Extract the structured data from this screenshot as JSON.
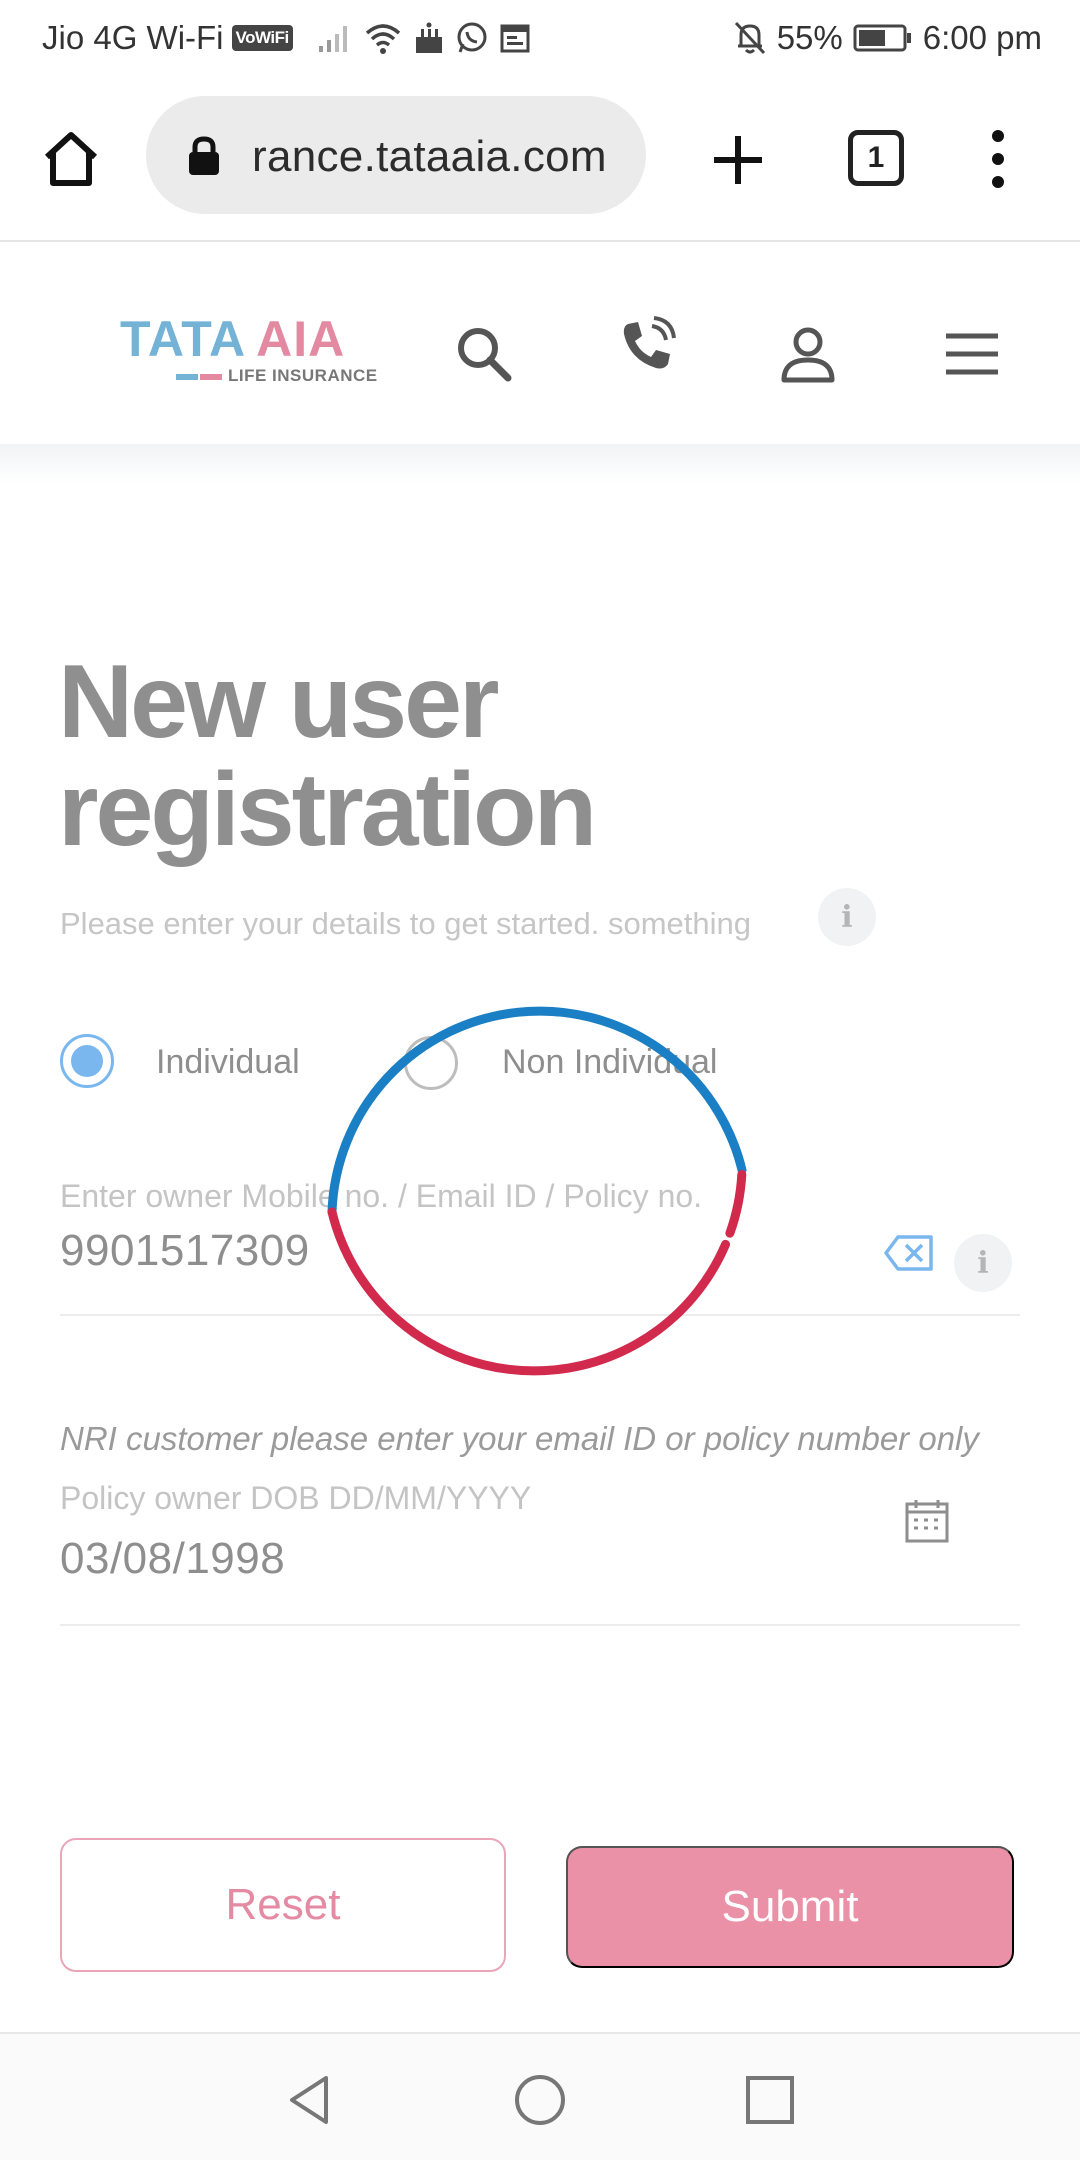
{
  "status_bar": {
    "carrier": "Jio 4G Wi-Fi",
    "volte": "VoWiFi",
    "battery": "55%",
    "time": "6:00 pm"
  },
  "browser": {
    "url": "rance.tataaia.com",
    "tab_count": "1"
  },
  "header": {
    "logo_tata": "TATA",
    "logo_aia": "AIA",
    "logo_sub": "LIFE INSURANCE"
  },
  "form": {
    "title": "New user registration",
    "subtitle": "Please enter your details to get started. something",
    "info_glyph": "i",
    "radio_individual": "Individual",
    "radio_non_individual": "Non Individual",
    "owner_label": "Enter owner Mobile no. / Email ID / Policy no.",
    "owner_value": "9901517309",
    "nri_hint": "NRI customer please enter your email ID or policy number only",
    "dob_label": "Policy owner DOB DD/MM/YYYY",
    "dob_value": "03/08/1998",
    "reset_label": "Reset",
    "submit_label": "Submit"
  },
  "colors": {
    "brand_blue": "#74b2d6",
    "brand_pink": "#e38aa2",
    "submit_bg": "#ea90a7",
    "ring_blue": "#1a7fc4",
    "ring_red": "#d22a4c"
  }
}
